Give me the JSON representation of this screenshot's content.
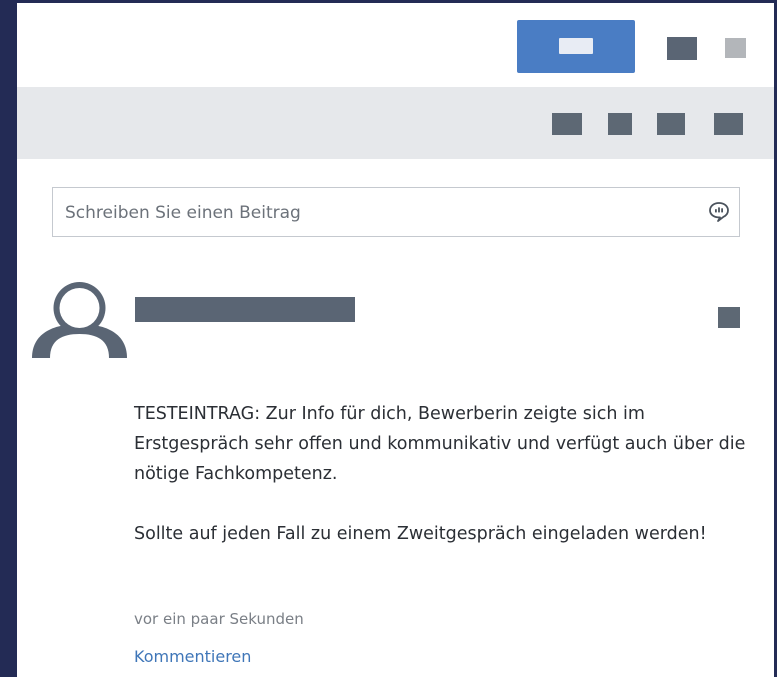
{
  "composer": {
    "placeholder": "Schreiben Sie einen Beitrag",
    "icon": "speech-bubble-icon"
  },
  "header": {
    "primary_button_icon": "label-placeholder",
    "icons": [
      "header-icon",
      "header-icon"
    ]
  },
  "toolbar": {
    "icons": [
      "toolbar-icon",
      "toolbar-icon",
      "toolbar-icon",
      "toolbar-icon"
    ]
  },
  "post": {
    "avatar_icon": "user-avatar-icon",
    "paragraphs": [
      "TESTEINTRAG: Zur Info für dich, Bewerberin zeigte sich im Erstgespräch sehr offen und kommunikativ und verfügt auch über die nötige Fachkompetenz.",
      "Sollte auf jeden Fall zu einem Zweitgespräch eingeladen werden!"
    ],
    "timestamp": "vor ein paar Sekunden",
    "comment_label": "Kommentieren"
  },
  "colors": {
    "background": "#232b55",
    "accent": "#4a7dc4",
    "link": "#3f76b8",
    "toolbar_bg": "#e6e8eb"
  }
}
